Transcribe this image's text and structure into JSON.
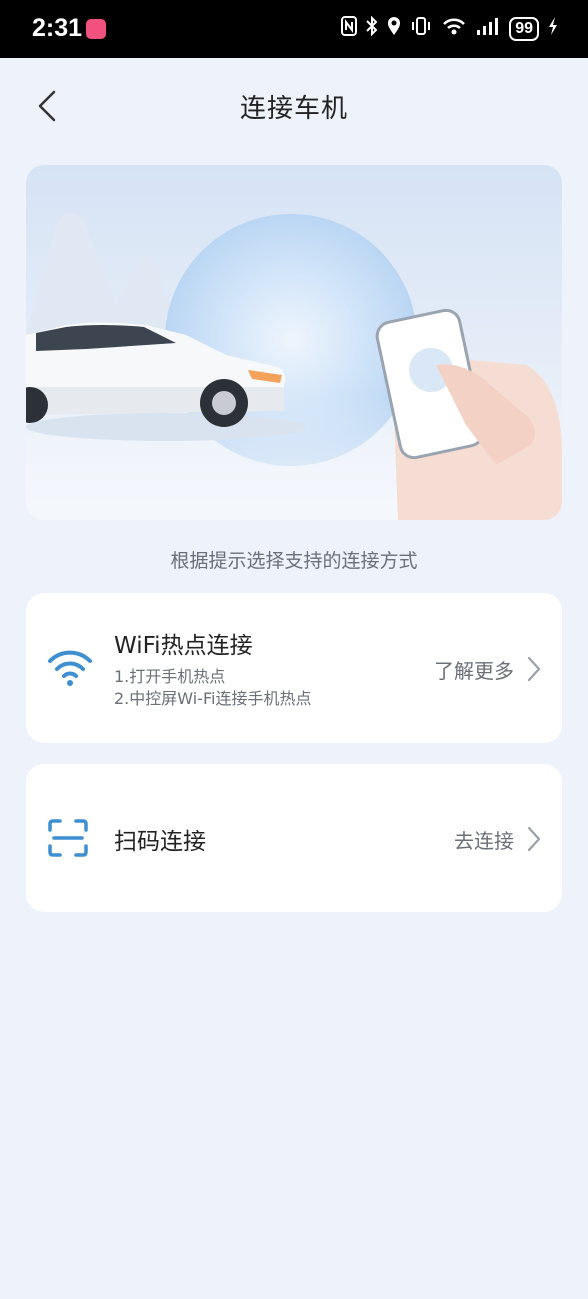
{
  "status_bar": {
    "time": "2:31",
    "battery": "99",
    "icons": [
      "nfc-icon",
      "bluetooth-icon",
      "location-icon",
      "vibrate-icon",
      "wifi-6-icon",
      "signal-icon",
      "battery-icon",
      "charging-icon"
    ]
  },
  "header": {
    "title": "连接车机",
    "back_icon": "chevron-left-icon"
  },
  "hint": "根据提示选择支持的连接方式",
  "options": {
    "wifi": {
      "title": "WiFi热点连接",
      "step1": "1.打开手机热点",
      "step2": "2.中控屏Wi-Fi连接手机热点",
      "action": "了解更多",
      "icon": "wifi-icon"
    },
    "qr": {
      "title": "扫码连接",
      "action": "去连接",
      "icon": "scan-icon"
    }
  },
  "colors": {
    "accent": "#3d8fd1",
    "background": "#eef3fb",
    "card": "#ffffff"
  }
}
